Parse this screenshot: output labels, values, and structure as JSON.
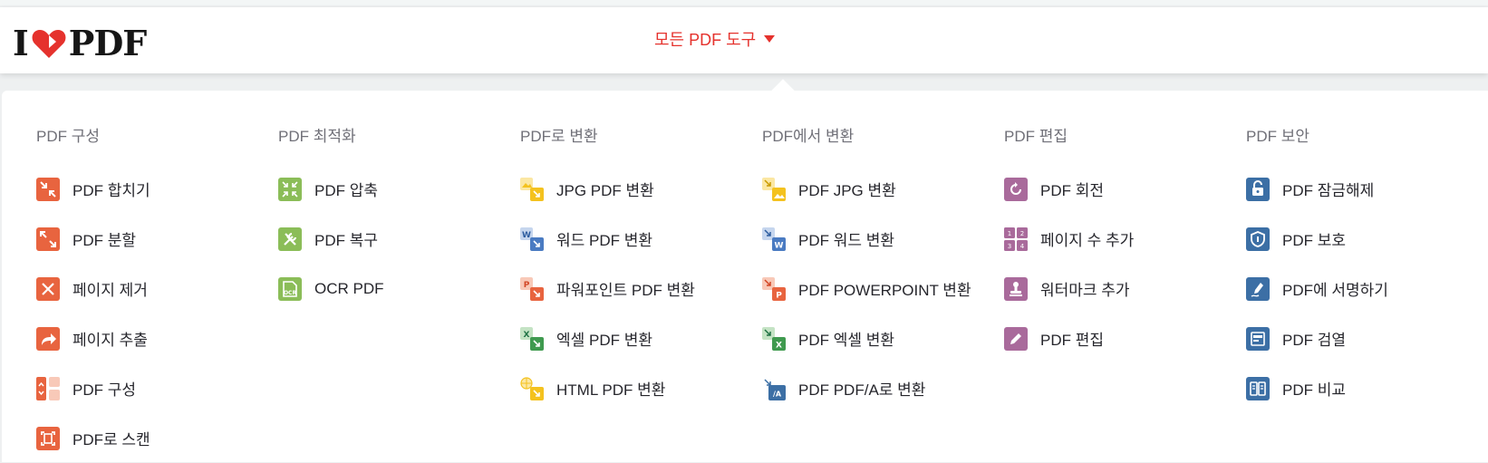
{
  "header": {
    "logo": {
      "left": "I",
      "right": "PDF"
    },
    "menu_label": "모든 PDF 도구"
  },
  "colors": {
    "brand": "#e5322d",
    "organize": "#e8643f",
    "optimize": "#8bbd58",
    "to_pdf": "#f4c21f",
    "from_pdf": "#f4c21f",
    "edit": "#a96a9b",
    "security": "#3c6fa5"
  },
  "columns": [
    {
      "title": "PDF 구성",
      "items": [
        {
          "label": "PDF 합치기",
          "icon": "merge-icon"
        },
        {
          "label": "PDF 분할",
          "icon": "split-icon"
        },
        {
          "label": "페이지 제거",
          "icon": "remove-pages-icon"
        },
        {
          "label": "페이지 추출",
          "icon": "extract-pages-icon"
        },
        {
          "label": "PDF 구성",
          "icon": "organize-icon"
        },
        {
          "label": "PDF로 스캔",
          "icon": "scan-icon"
        }
      ]
    },
    {
      "title": "PDF 최적화",
      "items": [
        {
          "label": "PDF 압축",
          "icon": "compress-icon"
        },
        {
          "label": "PDF 복구",
          "icon": "repair-icon"
        },
        {
          "label": "OCR PDF",
          "icon": "ocr-icon"
        }
      ]
    },
    {
      "title": "PDF로 변환",
      "items": [
        {
          "label": "JPG PDF 변환",
          "icon": "jpg-to-pdf-icon"
        },
        {
          "label": "워드 PDF 변환",
          "icon": "word-to-pdf-icon"
        },
        {
          "label": "파워포인트 PDF 변환",
          "icon": "powerpoint-to-pdf-icon"
        },
        {
          "label": "엑셀 PDF 변환",
          "icon": "excel-to-pdf-icon"
        },
        {
          "label": "HTML PDF 변환",
          "icon": "html-to-pdf-icon"
        }
      ]
    },
    {
      "title": "PDF에서 변환",
      "items": [
        {
          "label": "PDF JPG 변환",
          "icon": "pdf-to-jpg-icon"
        },
        {
          "label": "PDF 워드 변환",
          "icon": "pdf-to-word-icon"
        },
        {
          "label": "PDF POWERPOINT 변환",
          "icon": "pdf-to-powerpoint-icon"
        },
        {
          "label": "PDF 엑셀 변환",
          "icon": "pdf-to-excel-icon"
        },
        {
          "label": "PDF PDF/A로 변환",
          "icon": "pdf-to-pdfa-icon"
        }
      ]
    },
    {
      "title": "PDF 편집",
      "items": [
        {
          "label": "PDF 회전",
          "icon": "rotate-icon"
        },
        {
          "label": "페이지 수 추가",
          "icon": "page-numbers-icon"
        },
        {
          "label": "워터마크 추가",
          "icon": "watermark-icon"
        },
        {
          "label": "PDF 편집",
          "icon": "edit-pencil-icon"
        }
      ]
    },
    {
      "title": "PDF 보안",
      "items": [
        {
          "label": "PDF 잠금해제",
          "icon": "unlock-icon"
        },
        {
          "label": "PDF 보호",
          "icon": "shield-icon"
        },
        {
          "label": "PDF에 서명하기",
          "icon": "sign-icon"
        },
        {
          "label": "PDF 검열",
          "icon": "redact-icon"
        },
        {
          "label": "PDF 비교",
          "icon": "compare-icon"
        }
      ]
    }
  ]
}
